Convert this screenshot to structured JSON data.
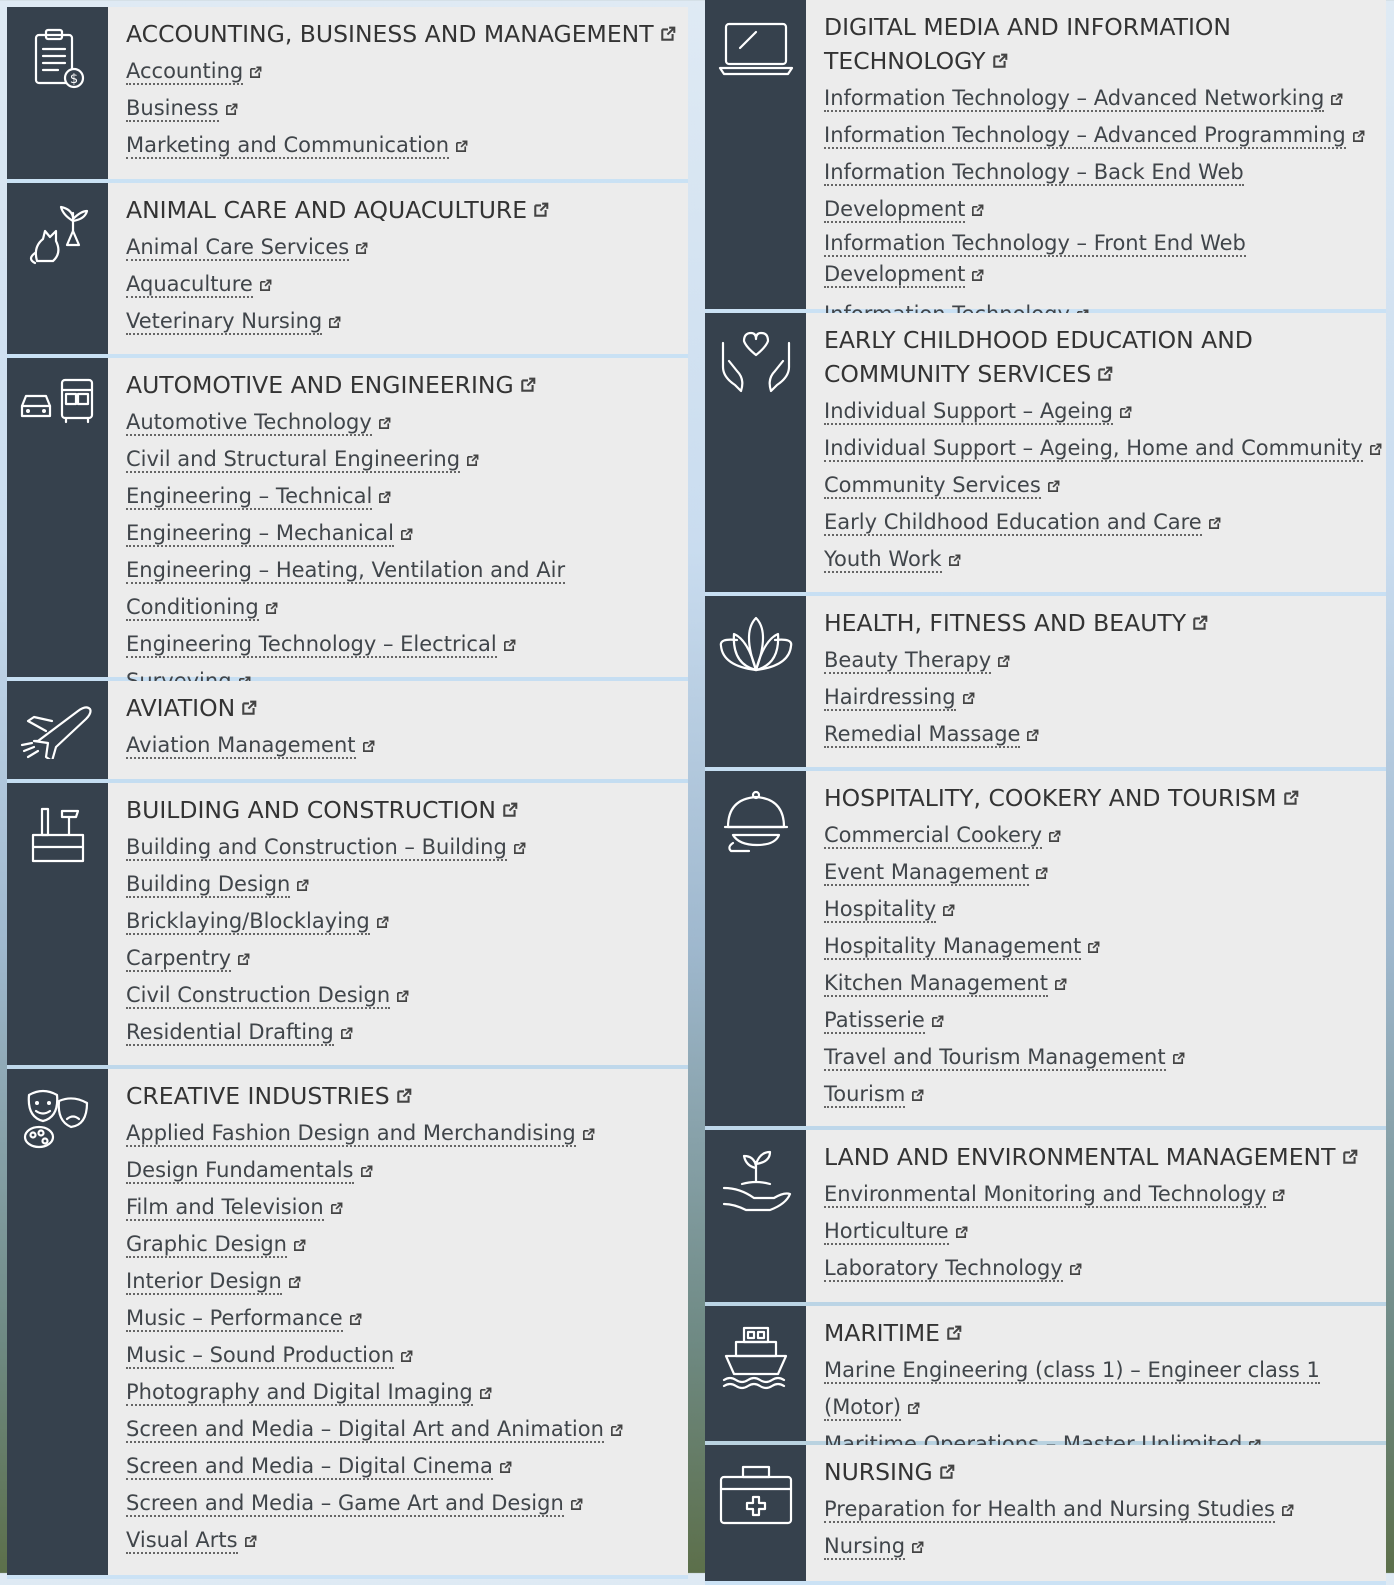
{
  "left_column": [
    {
      "title": "Accounting, Business and Management",
      "icon": "clipboard-dollar-icon",
      "courses": [
        "Accounting",
        "Business",
        "Marketing and Communication"
      ]
    },
    {
      "title": "Animal Care and Aquaculture",
      "icon": "cat-plant-icon",
      "courses": [
        "Animal Care Services",
        "Aquaculture",
        "Veterinary Nursing"
      ]
    },
    {
      "title": "Automotive and Engineering",
      "icon": "car-bus-icon",
      "courses": [
        "Automotive Technology",
        "Civil and Structural Engineering",
        "Engineering – Technical",
        "Engineering – Mechanical",
        "Engineering – Heating, Ventilation and Air Conditioning",
        "Engineering Technology – Electrical",
        "Surveying"
      ]
    },
    {
      "title": "Aviation",
      "icon": "airplane-icon",
      "courses": [
        "Aviation Management"
      ]
    },
    {
      "title": "Building and Construction",
      "icon": "toolbox-icon",
      "courses": [
        "Building and Construction – Building",
        "Building Design",
        "Bricklaying/Blocklaying",
        "Carpentry",
        "Civil Construction Design",
        "Residential Drafting"
      ]
    },
    {
      "title": "Creative Industries",
      "icon": "theatre-masks-icon",
      "courses": [
        "Applied Fashion Design and Merchandising",
        "Design Fundamentals",
        "Film and Television",
        "Graphic Design",
        "Interior Design",
        "Music – Performance",
        "Music – Sound Production",
        "Photography and Digital Imaging",
        "Screen and Media – Digital Art and Animation",
        "Screen and Media – Digital Cinema",
        "Screen and Media – Game Art and Design",
        "Visual Arts"
      ]
    }
  ],
  "right_column": [
    {
      "title": "Digital Media and Information Technology",
      "icon": "laptop-icon",
      "courses": [
        "Information Technology – Advanced Networking",
        "Information Technology – Advanced Programming",
        "Information Technology – Back End Web Development",
        "Information Technology – Front End Web Development",
        "Information Technology"
      ]
    },
    {
      "title": "Early Childhood Education and Community Services",
      "icon": "hands-heart-icon",
      "courses": [
        "Individual Support – Ageing",
        "Individual Support – Ageing, Home and Community",
        "Community Services",
        "Early Childhood Education and Care",
        "Youth Work"
      ]
    },
    {
      "title": "Health, Fitness and Beauty",
      "icon": "lotus-icon",
      "courses": [
        "Beauty Therapy",
        "Hairdressing",
        "Remedial Massage"
      ]
    },
    {
      "title": "Hospitality, Cookery and Tourism",
      "icon": "cloche-icon",
      "courses": [
        "Commercial Cookery",
        "Event Management",
        "Hospitality",
        "Hospitality Management",
        "Kitchen Management",
        "Patisserie",
        "Travel and Tourism Management",
        "Tourism"
      ]
    },
    {
      "title": "Land and Environmental Management",
      "icon": "sprout-hand-icon",
      "courses": [
        "Environmental Monitoring and Technology",
        "Horticulture",
        "Laboratory Technology"
      ]
    },
    {
      "title": "Maritime",
      "icon": "ship-icon",
      "courses": [
        "Marine Engineering (class 1) – Engineer class 1 (Motor)",
        "Maritime Operations – Master Unlimited"
      ]
    },
    {
      "title": "Nursing",
      "icon": "medical-kit-icon",
      "courses": [
        "Preparation for Health and Nursing Studies",
        "Nursing"
      ]
    }
  ],
  "colors": {
    "icon_panel": "#36414d",
    "card_bg": "#ececec",
    "text": "#333333",
    "divider": "#c8e1f5"
  }
}
